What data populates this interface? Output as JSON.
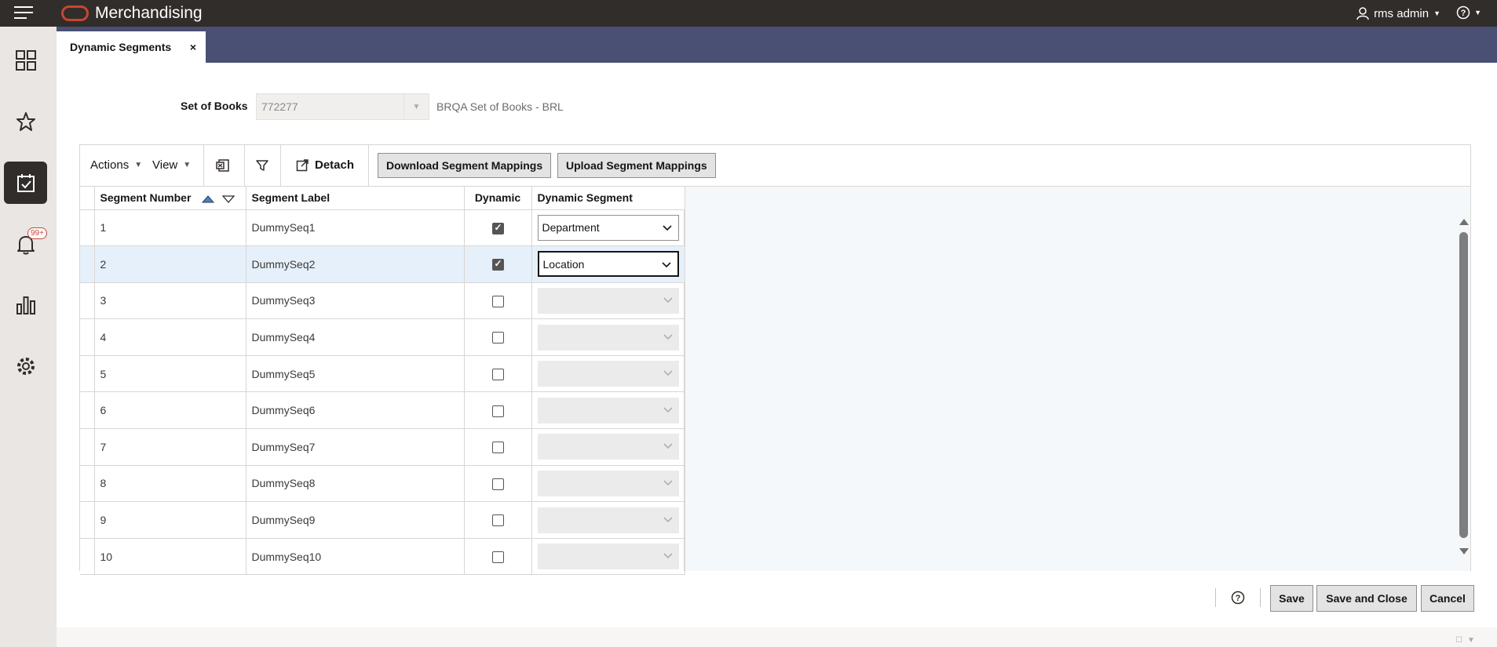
{
  "header": {
    "app_title": "Merchandising",
    "user_name": "rms admin",
    "menu_icon": "hamburger-menu-icon",
    "help_icon": "help-circle-icon",
    "accent_color": "#c74634"
  },
  "sidenav": {
    "items": [
      {
        "icon": "dashboard-grid-icon",
        "active": false
      },
      {
        "icon": "favorites-star-icon",
        "active": false
      },
      {
        "icon": "tasks-calendar-check-icon",
        "active": true
      },
      {
        "icon": "notifications-bell-icon",
        "active": false,
        "badge": "99+"
      },
      {
        "icon": "reports-bar-chart-icon",
        "active": false
      },
      {
        "icon": "settings-gear-icon",
        "active": false
      }
    ]
  },
  "tabs": [
    {
      "label": "Dynamic Segments",
      "close": "×"
    }
  ],
  "form": {
    "set_of_books_label": "Set of Books",
    "set_of_books_value": "772277",
    "set_of_books_desc": "BRQA Set of Books - BRL"
  },
  "toolbar": {
    "actions_label": "Actions",
    "view_label": "View",
    "detach_label": "Detach",
    "download_label": "Download Segment Mappings",
    "upload_label": "Upload Segment Mappings"
  },
  "table": {
    "columns": [
      "Segment Number",
      "Segment Label",
      "Dynamic",
      "Dynamic Segment"
    ],
    "rows": [
      {
        "number": "1",
        "label": "DummySeq1",
        "dynamic": true,
        "segment": "Department"
      },
      {
        "number": "2",
        "label": "DummySeq2",
        "dynamic": true,
        "segment": "Location",
        "selected": true
      },
      {
        "number": "3",
        "label": "DummySeq3",
        "dynamic": false,
        "segment": ""
      },
      {
        "number": "4",
        "label": "DummySeq4",
        "dynamic": false,
        "segment": ""
      },
      {
        "number": "5",
        "label": "DummySeq5",
        "dynamic": false,
        "segment": ""
      },
      {
        "number": "6",
        "label": "DummySeq6",
        "dynamic": false,
        "segment": ""
      },
      {
        "number": "7",
        "label": "DummySeq7",
        "dynamic": false,
        "segment": ""
      },
      {
        "number": "8",
        "label": "DummySeq8",
        "dynamic": false,
        "segment": ""
      },
      {
        "number": "9",
        "label": "DummySeq9",
        "dynamic": false,
        "segment": ""
      },
      {
        "number": "10",
        "label": "DummySeq10",
        "dynamic": false,
        "segment": ""
      }
    ]
  },
  "footer": {
    "save_label": "Save",
    "save_close_label": "Save and Close",
    "cancel_label": "Cancel"
  }
}
